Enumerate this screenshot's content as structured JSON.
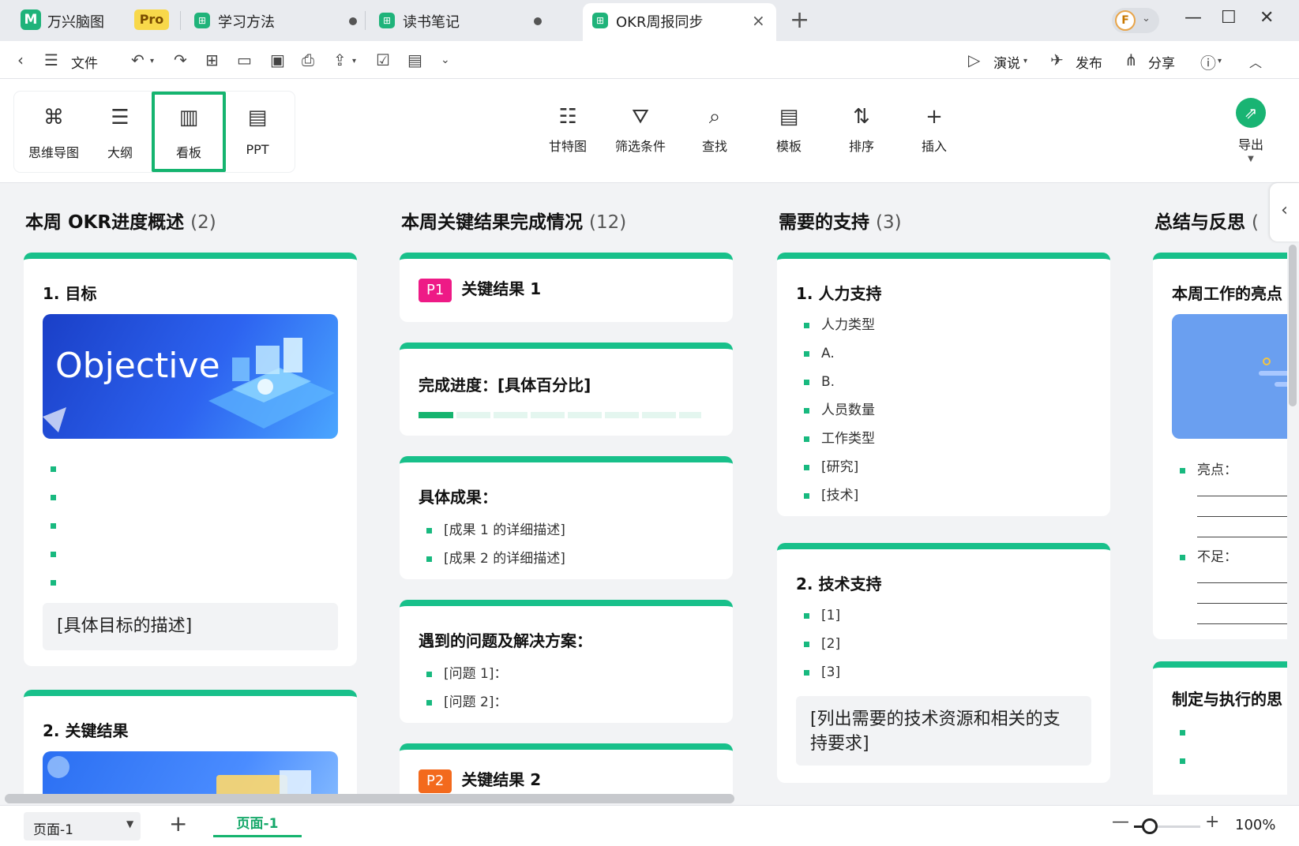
{
  "app": {
    "name": "万兴脑图",
    "badge": "Pro"
  },
  "tabs": [
    {
      "label": "学习方法"
    },
    {
      "label": "读书笔记"
    },
    {
      "label": "OKR周报同步",
      "close": "×"
    }
  ],
  "user": {
    "initial": "F"
  },
  "toolbar": {
    "file": "文件",
    "present": "演说",
    "publish": "发布",
    "share": "分享"
  },
  "views": [
    {
      "label": "思维导图",
      "icon": "mindmap-icon"
    },
    {
      "label": "大纲",
      "icon": "outline-icon"
    },
    {
      "label": "看板",
      "icon": "kanban-icon",
      "active": true
    },
    {
      "label": "PPT",
      "icon": "ppt-icon"
    }
  ],
  "ribbon": {
    "gantt": "甘特图",
    "filter": "筛选条件",
    "find": "查找",
    "template": "模板",
    "sort": "排序",
    "insert": "插入",
    "export": "导出"
  },
  "columns": [
    {
      "title": "本周 OKR进度概述",
      "count": "(2)",
      "cards": [
        {
          "title": "1. 目标",
          "banner": "Objective",
          "bullets": [
            "",
            "",
            "",
            "",
            ""
          ],
          "desc": "[具体目标的描述]"
        },
        {
          "title": "2. 关键结果"
        }
      ]
    },
    {
      "title": "本周关键结果完成情况",
      "count": "(12)",
      "cards": [
        {
          "tag": "P1",
          "title": "关键结果 1"
        },
        {
          "title": "完成进度：[具体百分比]",
          "progress": 0.125
        },
        {
          "title": "具体成果：",
          "bullets": [
            "[成果 1 的详细描述]",
            "[成果 2 的详细描述]"
          ]
        },
        {
          "title": "遇到的问题及解决方案：",
          "bullets": [
            "[问题 1]：",
            "[问题 2]："
          ]
        },
        {
          "tag": "P2",
          "title": "关键结果 2"
        }
      ]
    },
    {
      "title": "需要的支持",
      "count": "(3)",
      "cards": [
        {
          "title": "1. 人力支持",
          "bullets": [
            "人力类型",
            "A.",
            "B.",
            "人员数量",
            "工作类型",
            "[研究]",
            "[技术]"
          ]
        },
        {
          "title": "2. 技术支持",
          "bullets": [
            "[1]",
            "[2]",
            "[3]"
          ],
          "desc": "[列出需要的技术资源和相关的支持要求]"
        }
      ]
    },
    {
      "title": "总结与反思",
      "count": "(",
      "cards": [
        {
          "title": "本周工作的亮点",
          "bullets": [
            "亮点：",
            "不足："
          ]
        },
        {
          "title": "制定与执行的思",
          "bullets": [
            "",
            ""
          ]
        }
      ]
    }
  ],
  "status": {
    "page_select": "页面-1",
    "page_tab": "页面-1",
    "zoom": "100%"
  },
  "colors": {
    "accent": "#18c08a",
    "p1": "#ee1a86",
    "p2": "#f36a1d"
  }
}
